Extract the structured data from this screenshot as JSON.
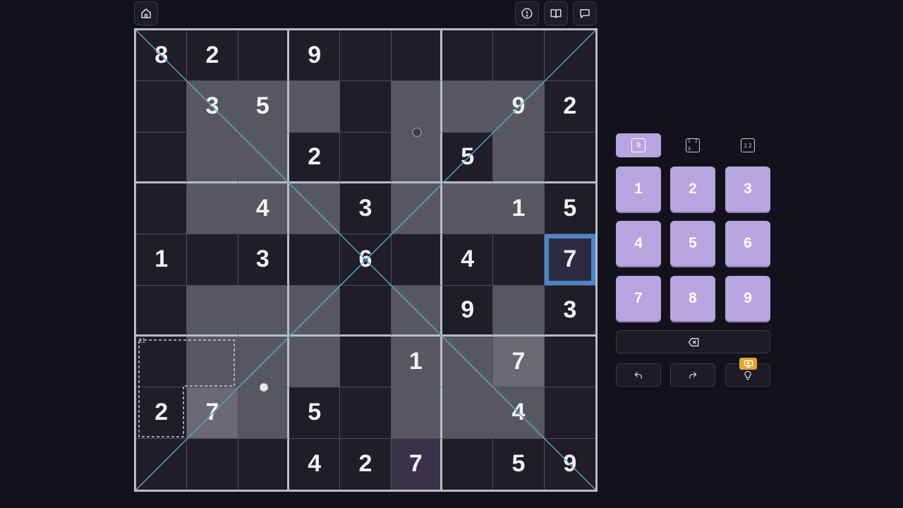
{
  "toolbar": {
    "home_icon": "home-icon",
    "info_icon": "alert-circle-icon",
    "rules_icon": "book-icon",
    "comments_icon": "comment-icon"
  },
  "grid": [
    [
      "8",
      "2",
      "",
      "9",
      "",
      "",
      "",
      "",
      ""
    ],
    [
      "",
      "3",
      "5",
      "",
      "",
      "",
      "",
      "9",
      "2"
    ],
    [
      "",
      "",
      "",
      "2",
      "",
      "",
      "5",
      "",
      ""
    ],
    [
      "",
      "",
      "4",
      "",
      "3",
      "",
      "",
      "1",
      "5"
    ],
    [
      "1",
      "",
      "3",
      "",
      "6",
      "",
      "4",
      "",
      "7"
    ],
    [
      "",
      "",
      "",
      "",
      "",
      "",
      "9",
      "",
      "3"
    ],
    [
      "",
      "",
      "",
      "",
      "",
      "1",
      "",
      "7",
      ""
    ],
    [
      "2",
      "7",
      "",
      "5",
      "",
      "",
      "",
      "4",
      ""
    ],
    [
      "",
      "",
      "",
      "4",
      "2",
      "7",
      "",
      "5",
      "9"
    ]
  ],
  "shading": [
    [
      "",
      "",
      "",
      "",
      "",
      "",
      "",
      "",
      ""
    ],
    [
      "",
      "shade",
      "shade",
      "shade",
      "",
      "shade",
      "shade",
      "shade",
      ""
    ],
    [
      "",
      "shade",
      "shade",
      "",
      "",
      "shade",
      "",
      "shade",
      ""
    ],
    [
      "",
      "shade",
      "shade",
      "shade",
      "",
      "shade",
      "shade",
      "shade",
      ""
    ],
    [
      "",
      "",
      "",
      "",
      "",
      "",
      "",
      "",
      ""
    ],
    [
      "",
      "shade",
      "shade",
      "shade",
      "",
      "shade",
      "",
      "shade",
      ""
    ],
    [
      "",
      "shade",
      "shade",
      "shade",
      "",
      "shade",
      "shade",
      "lite",
      ""
    ],
    [
      "",
      "lite",
      "shade",
      "",
      "",
      "shade",
      "shade",
      "shade",
      ""
    ],
    [
      "",
      "",
      "",
      "",
      "",
      "purple",
      "",
      "",
      ""
    ]
  ],
  "selected_cell": {
    "row": 4,
    "col": 8
  },
  "cage": {
    "sum": "11"
  },
  "modes": {
    "normal": "9",
    "corner": [
      "1",
      "2",
      "3"
    ],
    "center": "1 2"
  },
  "numpad": [
    "1",
    "2",
    "3",
    "4",
    "5",
    "6",
    "7",
    "8",
    "9"
  ],
  "controls": {
    "delete_icon": "backspace-icon",
    "undo_icon": "undo-icon",
    "redo_icon": "redo-icon",
    "hint_icon": "lightbulb-icon",
    "video_icon": "play-icon"
  },
  "colors": {
    "accent": "#b9a4e2",
    "selected_border": "#4a86c8",
    "diagonal": "#5aa5c8",
    "badge": "#e8a52b"
  }
}
